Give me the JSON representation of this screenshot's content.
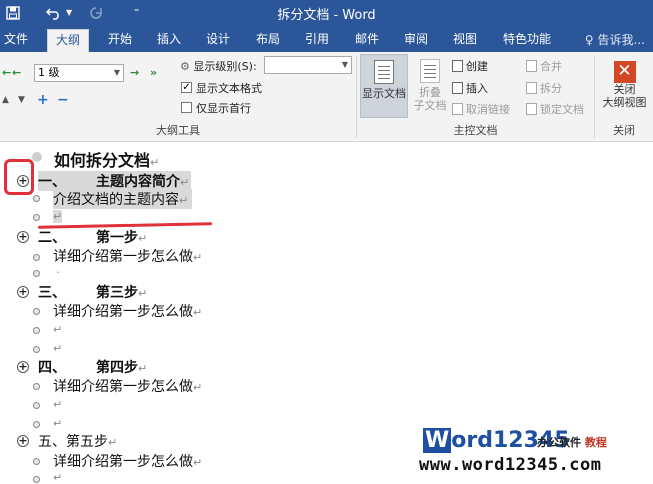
{
  "window": {
    "title": "拆分文档 - Word"
  },
  "tabs": [
    "文件",
    "大纲",
    "开始",
    "插入",
    "设计",
    "布局",
    "引用",
    "邮件",
    "审阅",
    "视图",
    "特色功能"
  ],
  "active_tab": "大纲",
  "tell_me": "告诉我...",
  "ribbon": {
    "outline_tools": {
      "level_value": "1 级",
      "show_level_label": "显示级别(S):",
      "show_text_format": "显示文本格式",
      "show_first_line": "仅显示首行",
      "label": "大纲工具"
    },
    "master_document": {
      "show_document": "显示文档",
      "collapse_subdocs_line1": "折叠",
      "collapse_subdocs_line2": "子文档",
      "create": "创建",
      "insert": "插入",
      "unlink": "取消链接",
      "merge": "合并",
      "split": "拆分",
      "lock_document": "锁定文档",
      "label": "主控文档"
    },
    "close": {
      "button_line1": "关闭",
      "button_line2": "大纲视图",
      "label": "关闭"
    }
  },
  "document": {
    "title": "如何拆分文档",
    "sections": [
      {
        "num": "一、",
        "heading": "主题内容简介",
        "body": "介绍文档的主题内容"
      },
      {
        "num": "二、",
        "heading": "第一步",
        "body": "详细介绍第一步怎么做"
      },
      {
        "num": "三、",
        "heading": "第三步",
        "body": "详细介绍第一步怎么做"
      },
      {
        "num": "四、",
        "heading": "第四步",
        "body": "详细介绍第一步怎么做"
      },
      {
        "num": "五、",
        "heading": "第五步",
        "body": "详细介绍第一步怎么做"
      }
    ],
    "para_mark": "↵"
  },
  "watermark": {
    "brand_w": "W",
    "brand_rest": "ord12345",
    "sub_a": "办公软件",
    "sub_b": "教程",
    "url": "www.word12345.com"
  }
}
